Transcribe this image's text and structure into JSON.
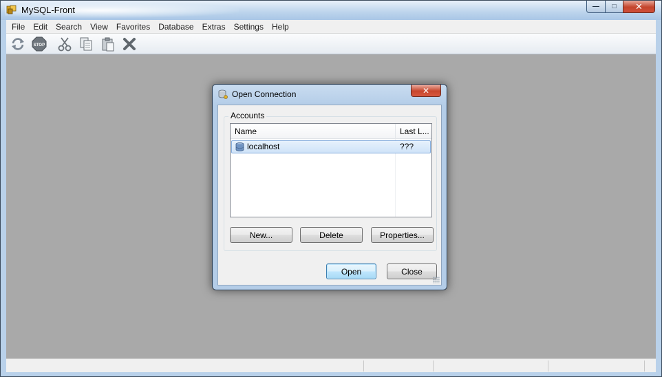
{
  "window": {
    "title": "MySQL-Front",
    "caption_buttons": {
      "minimize": "—",
      "maximize": "□",
      "close": "✕"
    }
  },
  "menu": {
    "items": [
      "File",
      "Edit",
      "Search",
      "View",
      "Favorites",
      "Database",
      "Extras",
      "Settings",
      "Help"
    ]
  },
  "toolbar": {
    "icons": [
      "refresh-icon",
      "stop-icon",
      "cut-icon",
      "copy-icon",
      "paste-icon",
      "delete-icon"
    ],
    "stop_label": "STOP"
  },
  "dialog": {
    "title": "Open Connection",
    "close_glyph": "✕",
    "group_label": "Accounts",
    "columns": [
      "Name",
      "Last L..."
    ],
    "rows": [
      {
        "name": "localhost",
        "last_login": "???"
      }
    ],
    "buttons": {
      "new": "New...",
      "delete": "Delete",
      "properties": "Properties...",
      "open": "Open",
      "close": "Close"
    }
  },
  "colors": {
    "workspace": "#a9a9a9",
    "selection": "#cfe3f8",
    "close_button": "#c8462d"
  }
}
